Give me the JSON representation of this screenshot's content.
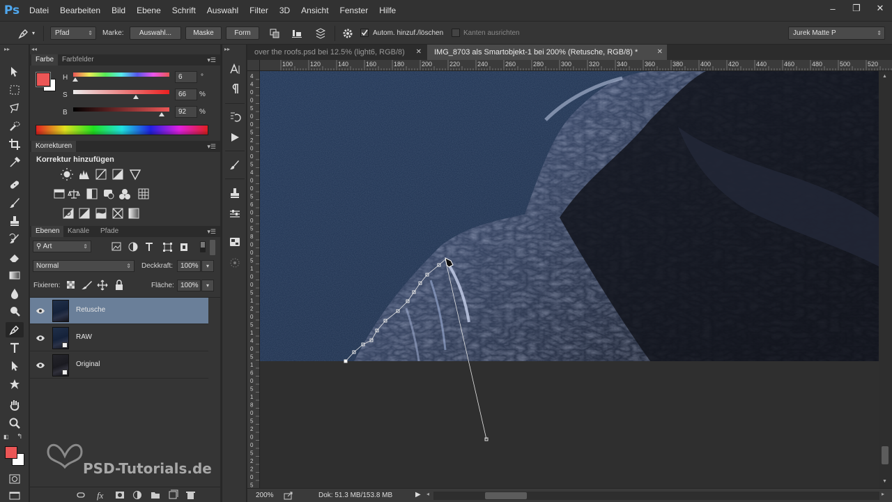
{
  "app": {
    "logo": "Ps"
  },
  "menu": [
    "Datei",
    "Bearbeiten",
    "Bild",
    "Ebene",
    "Schrift",
    "Auswahl",
    "Filter",
    "3D",
    "Ansicht",
    "Fenster",
    "Hilfe"
  ],
  "window_controls": {
    "minimize": "–",
    "restore": "❐",
    "close": "✕"
  },
  "options": {
    "mode": "Pfad",
    "make_label": "Marke:",
    "btn_selection": "Auswahl...",
    "btn_mask": "Maske",
    "btn_shape": "Form",
    "auto_add_label": "Autom. hinzuf./löschen",
    "align_edges_label": "Kanten ausrichten",
    "workspace": "Jurek Matte P"
  },
  "color_panel": {
    "tab_color": "Farbe",
    "tab_swatches": "Farbfelder",
    "h_label": "H",
    "h_value": "6",
    "h_unit": "°",
    "s_label": "S",
    "s_value": "66",
    "s_unit": "%",
    "b_label": "B",
    "b_value": "92",
    "b_unit": "%",
    "foreground": "#eb5656",
    "background": "#ffffff"
  },
  "adjustments_panel": {
    "tab": "Korrekturen",
    "heading": "Korrektur hinzufügen"
  },
  "layers_panel": {
    "tab_layers": "Ebenen",
    "tab_channels": "Kanäle",
    "tab_paths": "Pfade",
    "filter_kind": "Art",
    "blend_mode": "Normal",
    "opacity_label": "Deckkraft:",
    "opacity_value": "100%",
    "lock_label": "Fixieren:",
    "fill_label": "Fläche:",
    "fill_value": "100%",
    "layers": [
      {
        "name": "Retusche",
        "selected": true
      },
      {
        "name": "RAW",
        "selected": false
      },
      {
        "name": "Original",
        "selected": false
      }
    ]
  },
  "watermark": "PSD-Tutorials.de",
  "documents": {
    "tabs": [
      {
        "title": "over the roofs.psd bei 12.5% (light6, RGB/8)",
        "active": false
      },
      {
        "title": "IMG_8703 als Smartobjekt-1 bei 200% (Retusche, RGB/8) *",
        "active": true
      }
    ],
    "close_glyph": "✕"
  },
  "ruler": {
    "top_labels": [
      "100",
      "120",
      "140",
      "160",
      "180",
      "200",
      "220",
      "240",
      "260",
      "280",
      "300",
      "320",
      "340",
      "360",
      "380",
      "400",
      "420",
      "440",
      "460",
      "480",
      "500",
      "520"
    ],
    "left_digits": [
      "4",
      "4",
      "0",
      "0",
      "5",
      "0",
      "0",
      "5",
      "2",
      "0",
      "0",
      "5",
      "4",
      "0",
      "0",
      "5",
      "6",
      "0",
      "0",
      "5",
      "8",
      "0",
      "0",
      "5",
      "1",
      "0",
      "0",
      "5",
      "1",
      "2",
      "0",
      "5",
      "1",
      "4",
      "0",
      "5",
      "1",
      "6",
      "0",
      "5",
      "1",
      "8",
      "0",
      "5",
      "2",
      "0",
      "0",
      "5",
      "2",
      "2",
      "0",
      "5"
    ]
  },
  "status": {
    "zoom": "200%",
    "doc": "Dok: 51.3 MB/153.8 MB"
  }
}
